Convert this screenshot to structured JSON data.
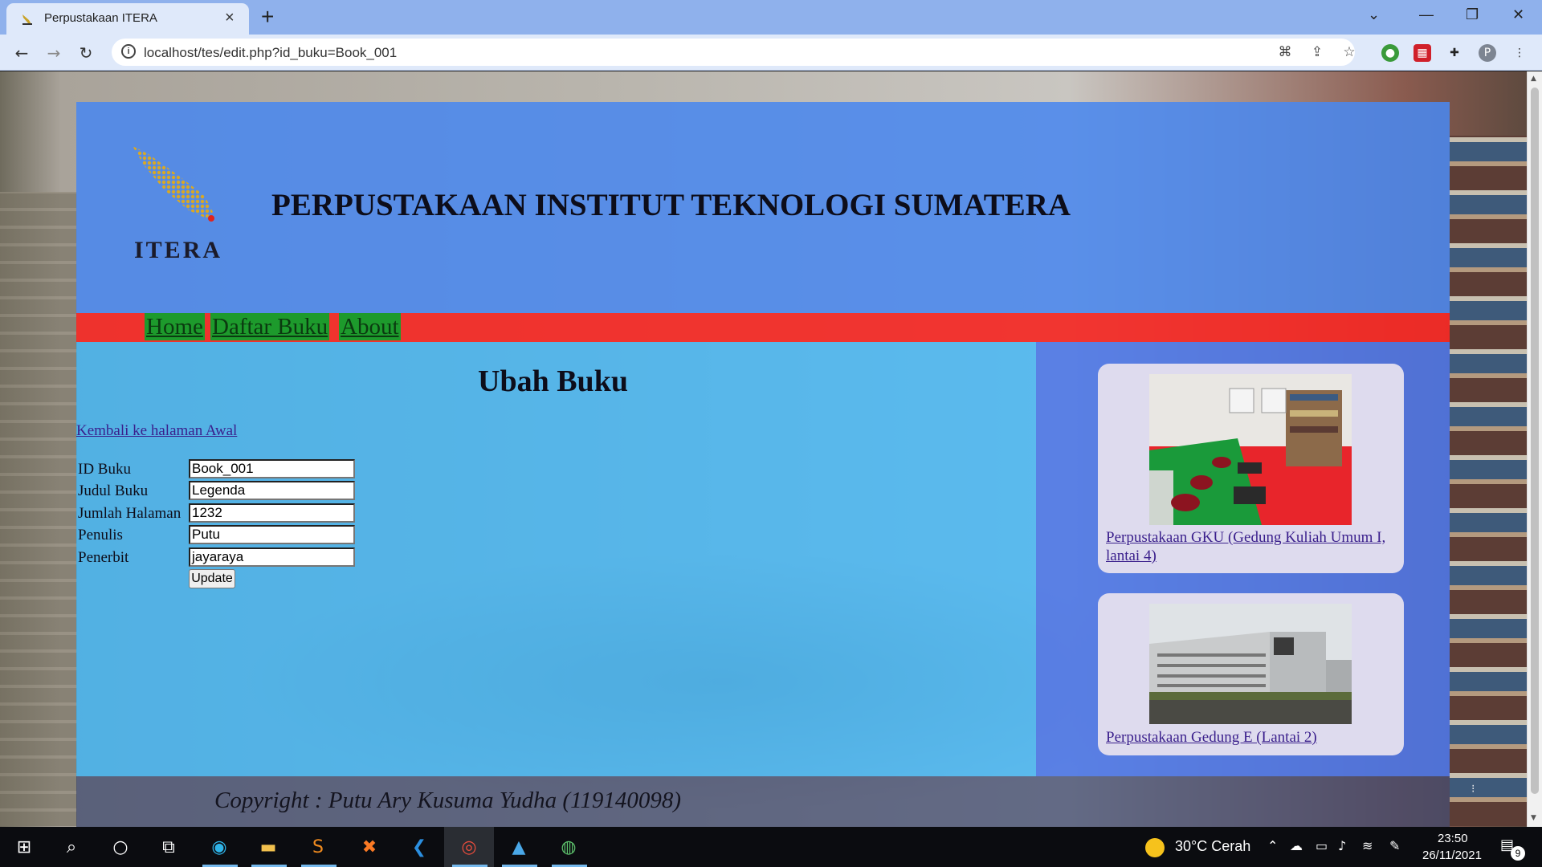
{
  "browser": {
    "tab_title": "Perpustakaan ITERA",
    "tab_close": "×",
    "new_tab": "+",
    "url": "localhost/tes/edit.php?id_buku=Book_001",
    "profile_initial": "P",
    "window_controls": {
      "minimize": "—",
      "maximize": "❐",
      "close": "✕",
      "tab_search": "⌄"
    }
  },
  "header": {
    "logo_text": "ITERA",
    "title": "PERPUSTAKAAN INSTITUT TEKNOLOGI SUMATERA"
  },
  "nav": {
    "items": [
      {
        "label": "Home"
      },
      {
        "label": "Daftar Buku"
      },
      {
        "label": "About"
      }
    ]
  },
  "main": {
    "heading": "Ubah Buku",
    "back_link": "Kembali ke halaman Awal",
    "form": {
      "fields": [
        {
          "label": "ID Buku",
          "value": "Book_001"
        },
        {
          "label": "Judul Buku",
          "value": "Legenda"
        },
        {
          "label": "Jumlah Halaman",
          "value": "1232"
        },
        {
          "label": "Penulis",
          "value": "Putu"
        },
        {
          "label": "Penerbit",
          "value": "jayaraya"
        }
      ],
      "submit_label": "Update"
    }
  },
  "sidebar": {
    "cards": [
      {
        "link": "Perpustakaan GKU (Gedung Kuliah Umum I, lantai 4)",
        "image": "library-interior-photo"
      },
      {
        "link": "Perpustakaan Gedung E (Lantai 2)",
        "image": "building-exterior-photo"
      }
    ]
  },
  "footer": {
    "copyright": "Copyright : Putu Ary Kusuma Yudha (119140098)"
  },
  "taskbar": {
    "weather": "30°C  Cerah",
    "time": "23:50",
    "date": "26/11/2021",
    "notification_count": "9",
    "apps": [
      "start-icon",
      "search-icon",
      "cortana-icon",
      "task-view-icon",
      "edge-icon",
      "file-explorer-icon",
      "sublime-text-icon",
      "xampp-icon",
      "vscode-icon",
      "chrome-icon",
      "photos-icon",
      "globe-app-icon"
    ]
  },
  "colors": {
    "header_bg": "#4a87ee",
    "navbar_bg": "#f42824",
    "nav_item_bg": "#1d9a2c",
    "content_bg": "#30b6ff",
    "card_bg": "#dedbee",
    "link_color": "#3a1f8c"
  }
}
